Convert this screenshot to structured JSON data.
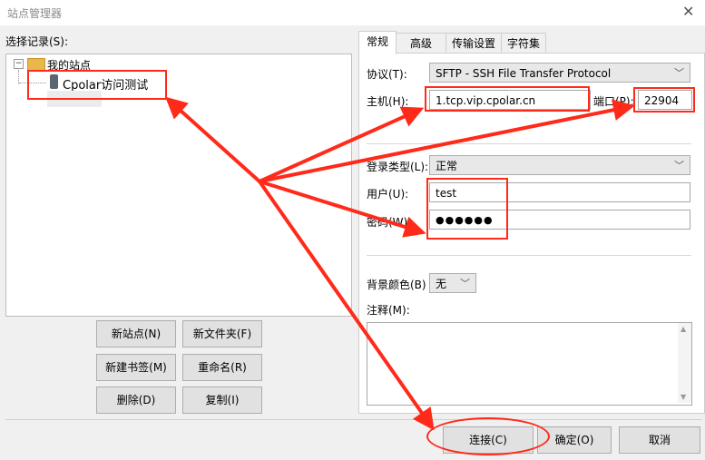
{
  "window": {
    "title": "站点管理器"
  },
  "left": {
    "select_label": "选择记录(S):",
    "tree": {
      "root": "我的站点",
      "site": "Cpolar访问测试"
    },
    "buttons": {
      "new_site": "新站点(N)",
      "new_folder": "新文件夹(F)",
      "new_bookmark": "新建书签(M)",
      "rename": "重命名(R)",
      "delete": "删除(D)",
      "copy": "复制(I)"
    }
  },
  "tabs": [
    "常规",
    "高级",
    "传输设置",
    "字符集"
  ],
  "general": {
    "protocol_label": "协议(T):",
    "protocol_value": "SFTP - SSH File Transfer Protocol",
    "host_label": "主机(H):",
    "host_value": "1.tcp.vip.cpolar.cn",
    "port_label": "端口(P):",
    "port_value": "22904",
    "login_type_label": "登录类型(L):",
    "login_type_value": "正常",
    "user_label": "用户(U):",
    "user_value": "test",
    "password_label": "密码(W):",
    "password_value": "●●●●●●",
    "bgcolor_label": "背景颜色(B)",
    "bgcolor_value": "无",
    "comment_label": "注释(M):"
  },
  "bottom_buttons": {
    "connect": "连接(C)",
    "ok": "确定(O)",
    "cancel": "取消"
  },
  "colors": {
    "annotation": "#ff2a1a"
  }
}
